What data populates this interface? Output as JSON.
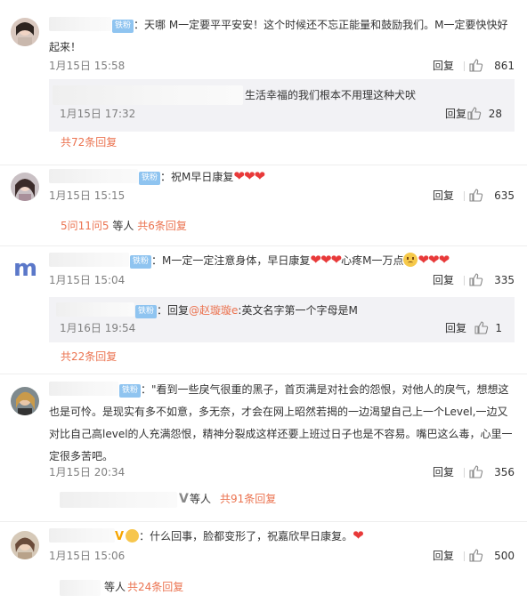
{
  "reply_label": "回复",
  "comments": [
    {
      "text": "：天哪 M一定要平平安安！这个时候还不忘正能量和鼓励我们。M一定要快快好起来！",
      "time": "1月15日 15:58",
      "likes": "861",
      "sub": {
        "text": "生活幸福的我们根本不用理这种犬吠",
        "time": "1月15日 17:32",
        "likes": "28"
      },
      "more": "共72条回复"
    },
    {
      "text": "：祝M早日康复",
      "hearts": "❤❤❤",
      "time": "1月15日 15:15",
      "likes": "635",
      "more_prefix": "5问11问5",
      "more_mid": " 等人 ",
      "more": "共6条回复"
    },
    {
      "text_a": "：M一定一定注意身体，早日康复",
      "hearts_a": "❤❤❤",
      "text_b": "心疼M一万点",
      "hearts_b": "❤❤❤",
      "time": "1月15日 15:04",
      "likes": "335",
      "sub": {
        "prefix": "：回复",
        "mention": "@赵璇璇e",
        "text": ":英文名字第一个字母是M",
        "time": "1月16日 19:54",
        "likes": "1"
      },
      "more": "共22条回复"
    },
    {
      "text": "：\"看到一些戾气很重的黑子，首页满是对社会的怨恨，对他人的戾气，想想这也是可怜。是现实有多不如意，多无奈，才会在网上昭然若揭的一边渴望自己上一个Level,一边又对比自己高level的人充满怨恨，精神分裂成这样还要上班过日子也是不容易。嘴巴这么毒，心里一定很多苦吧。",
      "time": "1月15日 20:34",
      "likes": "356",
      "more_mid": " 等人 ",
      "more": "共91条回复"
    },
    {
      "text": "：什么回事，脸都变形了，祝嘉欣早日康复。",
      "hearts": "❤",
      "time": "1月15日 15:06",
      "likes": "500",
      "more_mid": "等人 ",
      "more": "共24条回复"
    }
  ],
  "fan_badge": "铁粉",
  "colors": {
    "link": "#eb7350",
    "badge": "#8fc4f0",
    "heart": "#e83a3a",
    "subbox": "#f2f2f5"
  }
}
